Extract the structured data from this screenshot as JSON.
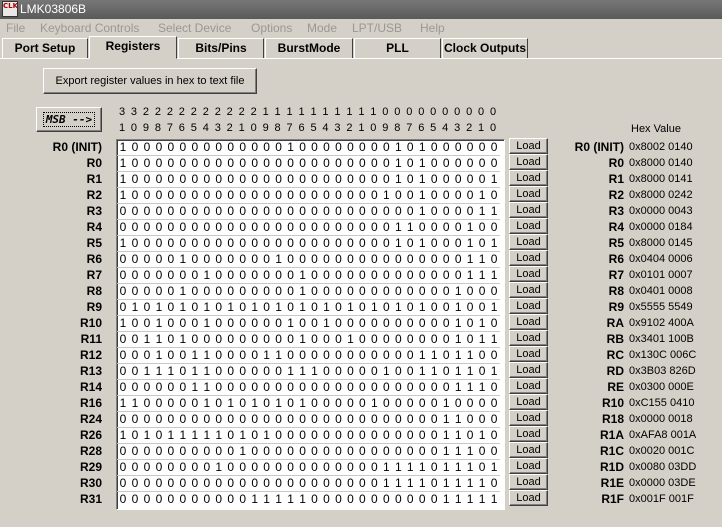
{
  "window": {
    "title": "LMK03806B",
    "icon_text": "CLK"
  },
  "menu": [
    "File",
    "Keyboard Controls",
    "Select Device",
    "Options",
    "Mode",
    "LPT/USB",
    "Help"
  ],
  "tabs": [
    {
      "label": "Port Setup",
      "active": false
    },
    {
      "label": "Registers",
      "active": true
    },
    {
      "label": "Bits/Pins",
      "active": false
    },
    {
      "label": "BurstMode",
      "active": false
    },
    {
      "label": "PLL",
      "active": false
    },
    {
      "label": "Clock Outputs",
      "active": false
    }
  ],
  "export_button": "Export register values in hex to text file",
  "msb_button": "MSB -->",
  "bit_index_tens": "33222222222211111111110000000000",
  "bit_index_ones": "10987654321098765432109876543210",
  "hex_header": "Hex Value",
  "load_label": "Load",
  "registers": [
    {
      "name": "R0 (INIT)",
      "bits": "10000000000000100000000101000000",
      "hex_name": "R0 (INIT)",
      "hex": "0x8002 0140"
    },
    {
      "name": "R0",
      "bits": "10000000000000000000000101000000",
      "hex_name": "R0",
      "hex": "0x8000 0140"
    },
    {
      "name": "R1",
      "bits": "10000000000000000000000101000001",
      "hex_name": "R1",
      "hex": "0x8000 0141"
    },
    {
      "name": "R2",
      "bits": "10000000000000000000001001000010",
      "hex_name": "R2",
      "hex": "0x8000 0242"
    },
    {
      "name": "R3",
      "bits": "00000000000000000000000001000011",
      "hex_name": "R3",
      "hex": "0x0000 0043"
    },
    {
      "name": "R4",
      "bits": "00000000000000000000000110000100",
      "hex_name": "R4",
      "hex": "0x0000 0184"
    },
    {
      "name": "R5",
      "bits": "10000000000000000000000101000101",
      "hex_name": "R5",
      "hex": "0x8000 0145"
    },
    {
      "name": "R6",
      "bits": "00000100000001000000000000000110",
      "hex_name": "R6",
      "hex": "0x0404 0006"
    },
    {
      "name": "R7",
      "bits": "00000001000000010000000000000111",
      "hex_name": "R7",
      "hex": "0x0101 0007"
    },
    {
      "name": "R8",
      "bits": "00000100000000010000000000001000",
      "hex_name": "R8",
      "hex": "0x0401 0008"
    },
    {
      "name": "R9",
      "bits": "01010101010101010101010101001001",
      "hex_name": "R9",
      "hex": "0x5555 5549"
    },
    {
      "name": "R10",
      "bits": "10010001000000100100000000001010",
      "hex_name": "RA",
      "hex": "0x9102 400A"
    },
    {
      "name": "R11",
      "bits": "00110100000000010001000000001011",
      "hex_name": "RB",
      "hex": "0x3401 100B"
    },
    {
      "name": "R12",
      "bits": "00010011000011000000000001101100",
      "hex_name": "RC",
      "hex": "0x130C 006C"
    },
    {
      "name": "R13",
      "bits": "00111011000000111000001001101101",
      "hex_name": "RD",
      "hex": "0x3B03 826D"
    },
    {
      "name": "R14",
      "bits": "00000011000000000000000000001110",
      "hex_name": "RE",
      "hex": "0x0300 000E"
    },
    {
      "name": "R16",
      "bits": "11000001010101010000010000010000",
      "hex_name": "R10",
      "hex": "0xC155 0410"
    },
    {
      "name": "R24",
      "bits": "00000000000000000000000000011000",
      "hex_name": "R18",
      "hex": "0x0000 0018"
    },
    {
      "name": "R26",
      "bits": "10101111101010000000000000011010",
      "hex_name": "R1A",
      "hex": "0xAFA8 001A"
    },
    {
      "name": "R28",
      "bits": "00000000001000000000000000011100",
      "hex_name": "R1C",
      "hex": "0x0020 001C"
    },
    {
      "name": "R29",
      "bits": "00000000100000000000001111011101",
      "hex_name": "R1D",
      "hex": "0x0080 03DD"
    },
    {
      "name": "R30",
      "bits": "00000000000000000000001111011110",
      "hex_name": "R1E",
      "hex": "0x0000 03DE"
    },
    {
      "name": "R31",
      "bits": "00000000000111110000000000011111",
      "hex_name": "R1F",
      "hex": "0x001F 001F"
    }
  ]
}
